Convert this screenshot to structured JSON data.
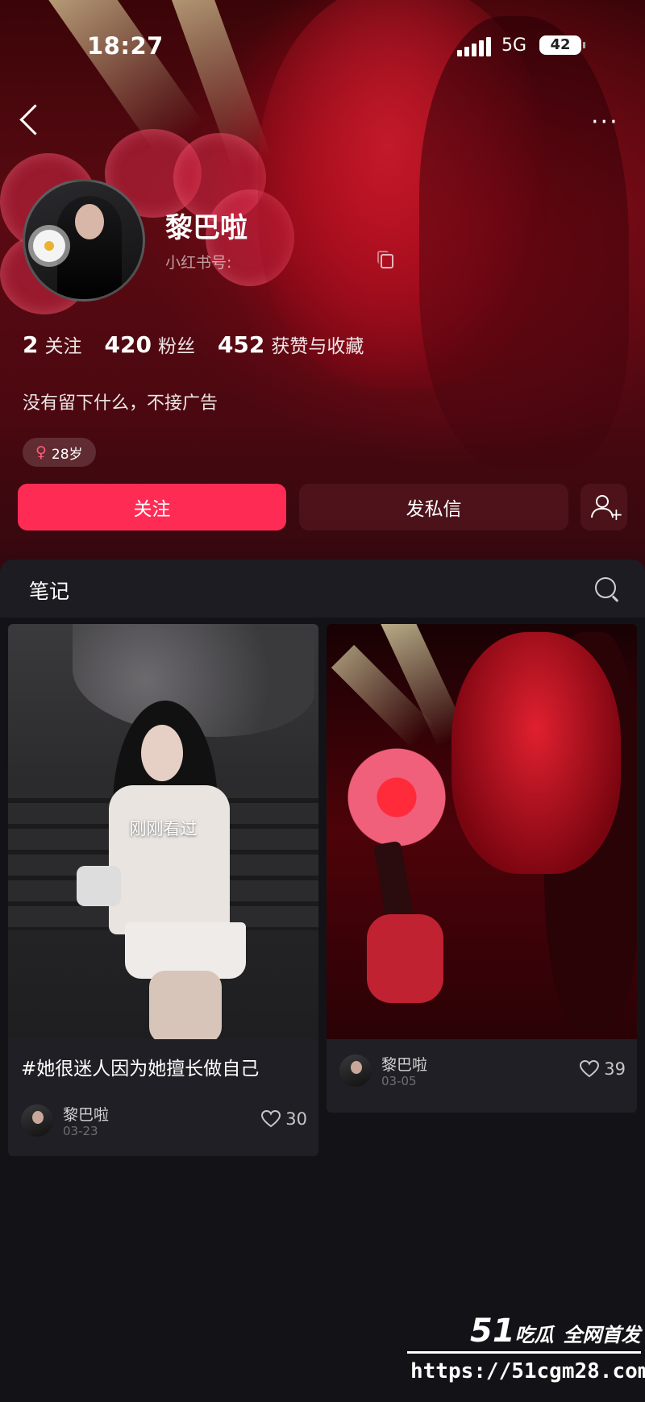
{
  "status_bar": {
    "time": "18:27",
    "network": "5G",
    "battery": "42"
  },
  "nav": {
    "more_label": "···"
  },
  "profile": {
    "name": "黎巴啦",
    "redbook_id_label": "小红书号:",
    "stats": [
      {
        "value": "2",
        "label": "关注"
      },
      {
        "value": "420",
        "label": "粉丝"
      },
      {
        "value": "452",
        "label": "获赞与收藏"
      }
    ],
    "bio": "没有留下什么，不接广告",
    "tag_symbol": "♀",
    "age_tag": "28岁",
    "accent_color": "#fe2c55"
  },
  "actions": {
    "follow": "关注",
    "message": "发私信",
    "add_plus": "+"
  },
  "tabs": {
    "notes": "笔记"
  },
  "notes": [
    {
      "overlay": "刚刚看过",
      "title": "#她很迷人因为她擅长做自己",
      "author": "黎巴啦",
      "date": "03-23",
      "likes": "30"
    },
    {
      "author": "黎巴啦",
      "date": "03-05",
      "likes": "39"
    }
  ],
  "watermark": {
    "big": "51",
    "text1": "吃瓜",
    "text2": "全网首发",
    "url": "https://51cgm28.com"
  }
}
